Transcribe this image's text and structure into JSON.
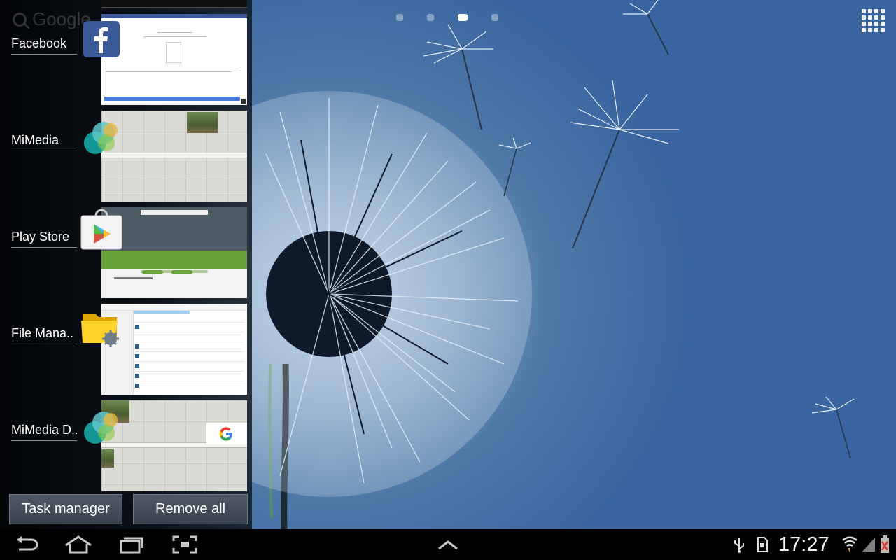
{
  "home": {
    "page_dots": [
      false,
      false,
      true,
      false
    ],
    "apps_button_icon": "apps-grid-icon",
    "wallpaper": "dandelion"
  },
  "recents": {
    "search_ghost": "Google",
    "items": [
      {
        "label": "Facebook",
        "icon": "facebook-icon"
      },
      {
        "label": "MiMedia",
        "icon": "mimedia-icon"
      },
      {
        "label": "Play Store",
        "icon": "play-store-icon"
      },
      {
        "label": "File Mana..",
        "icon": "file-manager-icon"
      },
      {
        "label": "MiMedia D..",
        "icon": "mimedia-icon"
      }
    ],
    "task_manager_label": "Task manager",
    "remove_all_label": "Remove all"
  },
  "navbar": {
    "buttons": [
      "back-icon",
      "home-icon",
      "recent-apps-icon",
      "screenshot-icon",
      "chevron-up-icon"
    ],
    "status_icons": [
      "usb-icon",
      "sd-card-icon",
      "wifi-icon",
      "signal-icon",
      "battery-icon"
    ],
    "time": "17:27"
  },
  "colors": {
    "wallpaper_blue": "#3a65a0",
    "facebook_blue": "#3b5998",
    "play_green": "#69a23a"
  }
}
